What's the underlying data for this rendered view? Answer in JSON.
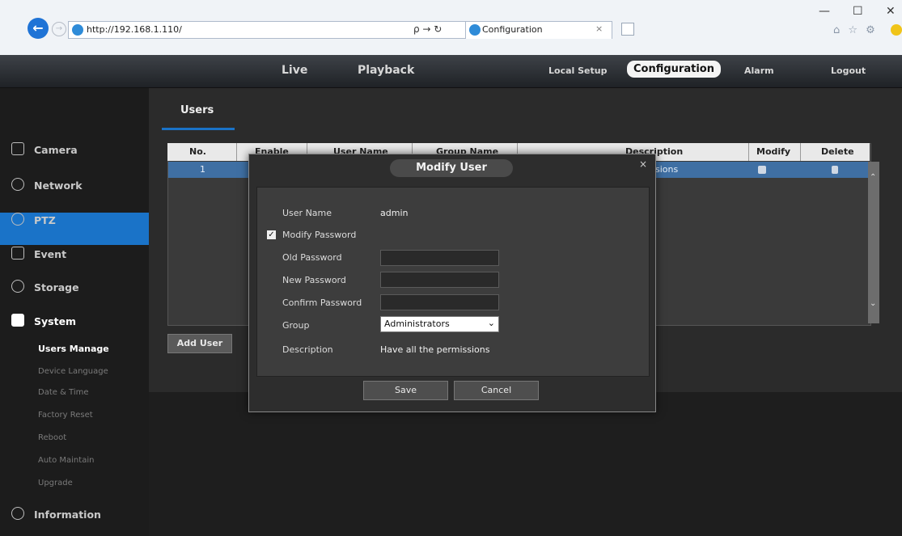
{
  "browser": {
    "url": "http://192.168.1.110/",
    "addr_tools": "ρ → ↻",
    "tab_title": "Configuration",
    "tab_close": "×",
    "minimize": "—",
    "maximize": "☐",
    "close": "✕",
    "toolbar_icons": "⌂ ☆ ⚙"
  },
  "topnav": {
    "live": "Live",
    "playback": "Playback",
    "local_setup": "Local Setup",
    "configuration": "Configuration",
    "alarm": "Alarm",
    "logout": "Logout"
  },
  "sidebar": {
    "items": [
      {
        "label": "Camera"
      },
      {
        "label": "Network"
      },
      {
        "label": "PTZ"
      },
      {
        "label": "Event"
      },
      {
        "label": "Storage"
      },
      {
        "label": "System"
      },
      {
        "label": "Information"
      }
    ],
    "sub_items": [
      {
        "label": "Users Manage"
      },
      {
        "label": "Device Language"
      },
      {
        "label": "Date & Time"
      },
      {
        "label": "Factory Reset"
      },
      {
        "label": "Reboot"
      },
      {
        "label": "Auto Maintain"
      },
      {
        "label": "Upgrade"
      }
    ]
  },
  "users": {
    "tab": "Users",
    "columns": [
      "No.",
      "Enable",
      "User Name",
      "Group Name",
      "Description",
      "Modify",
      "Delete"
    ],
    "row": {
      "no": "1",
      "description_tail": "sions"
    },
    "add_user": "Add User"
  },
  "modal": {
    "title": "Modify User",
    "close": "×",
    "user_name_label": "User Name",
    "user_name_value": "admin",
    "modify_password_label": "Modify Password",
    "modify_password_checked": true,
    "old_password_label": "Old Password",
    "new_password_label": "New Password",
    "confirm_password_label": "Confirm Password",
    "group_label": "Group",
    "group_value": "Administrators",
    "description_label": "Description",
    "description_value": "Have all the permissions",
    "save": "Save",
    "cancel": "Cancel"
  },
  "colors": {
    "accent": "#1a73c8",
    "selected_row": "#3f6fa3"
  }
}
